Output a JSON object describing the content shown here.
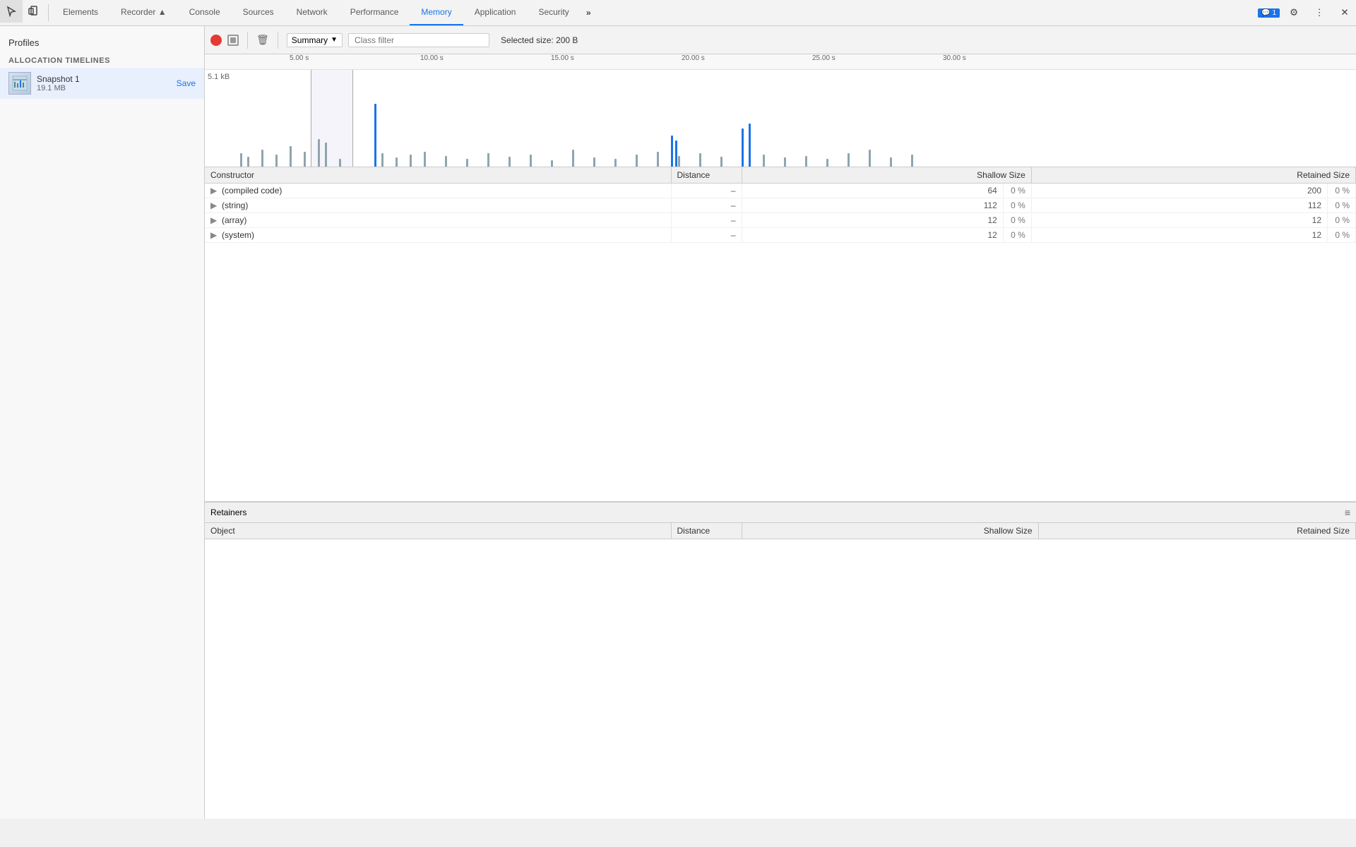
{
  "tabs": [
    {
      "label": "Elements",
      "active": false
    },
    {
      "label": "Recorder ▲",
      "active": false
    },
    {
      "label": "Console",
      "active": false
    },
    {
      "label": "Sources",
      "active": false
    },
    {
      "label": "Network",
      "active": false
    },
    {
      "label": "Performance",
      "active": false
    },
    {
      "label": "Memory",
      "active": true
    },
    {
      "label": "Application",
      "active": false
    },
    {
      "label": "Security",
      "active": false
    }
  ],
  "sidebar": {
    "profiles_label": "Profiles",
    "section_label": "ALLOCATION TIMELINES",
    "snapshot": {
      "name": "Snapshot 1",
      "size": "19.1 MB",
      "save_label": "Save"
    }
  },
  "toolbar": {
    "summary_label": "Summary",
    "class_filter_placeholder": "Class filter",
    "selected_size_label": "Selected size: 200 B"
  },
  "timeline": {
    "size_label": "5.1 kB",
    "marks": [
      "5.00 s",
      "10.00 s",
      "15.00 s",
      "20.00 s",
      "25.00 s",
      "30.00 s"
    ]
  },
  "constructor_table": {
    "columns": [
      "Constructor",
      "Distance",
      "Shallow Size",
      "",
      "Retained Size",
      ""
    ],
    "rows": [
      {
        "constructor": "(compiled code)",
        "distance": "–",
        "shallow": "64",
        "shallow_pct": "0 %",
        "retained": "200",
        "retained_pct": "0 %"
      },
      {
        "constructor": "(string)",
        "distance": "–",
        "shallow": "112",
        "shallow_pct": "0 %",
        "retained": "112",
        "retained_pct": "0 %"
      },
      {
        "constructor": "(array)",
        "distance": "–",
        "shallow": "12",
        "shallow_pct": "0 %",
        "retained": "12",
        "retained_pct": "0 %"
      },
      {
        "constructor": "(system)",
        "distance": "–",
        "shallow": "12",
        "shallow_pct": "0 %",
        "retained": "12",
        "retained_pct": "0 %"
      }
    ]
  },
  "retainers": {
    "header_label": "Retainers",
    "columns": [
      "Object",
      "Distance",
      "Shallow Size",
      "Retained Size"
    ]
  },
  "notification": {
    "icon": "💬",
    "count": "1"
  }
}
